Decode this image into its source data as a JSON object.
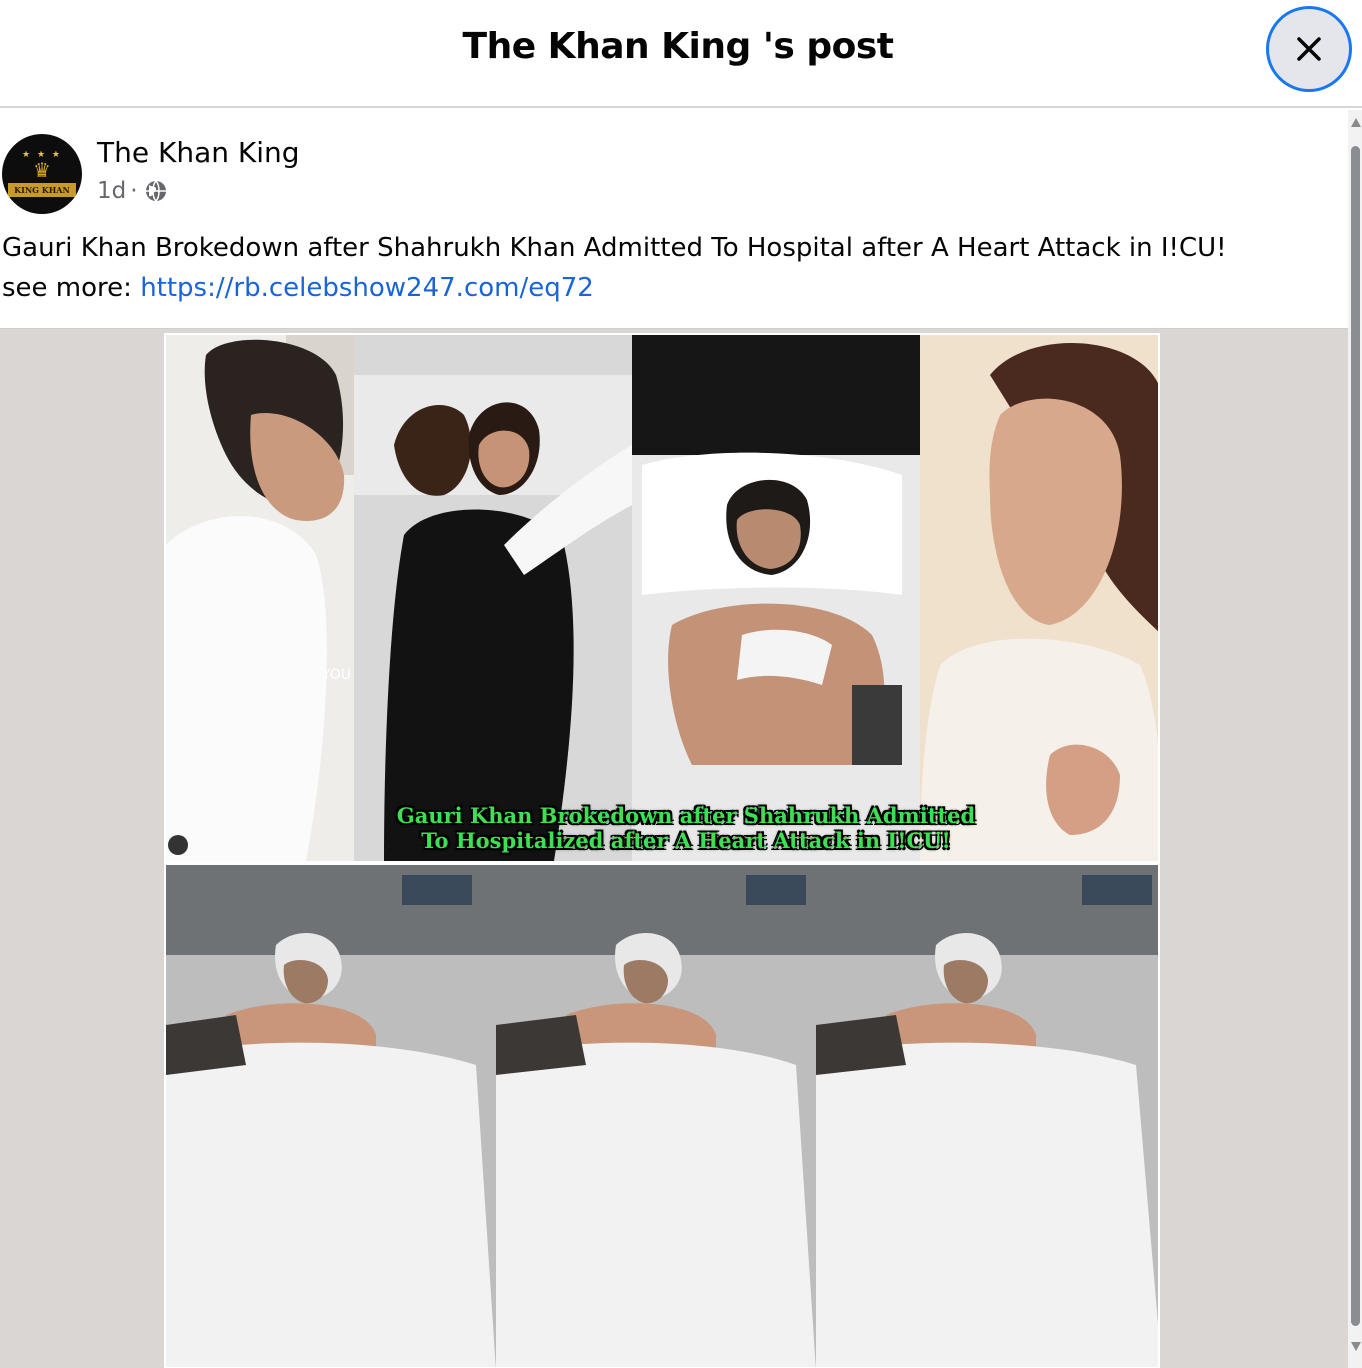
{
  "header": {
    "title": "The Khan King 's post",
    "close_icon": "close-icon"
  },
  "post": {
    "author": "The Khan King",
    "time": "1d",
    "separator": "·",
    "privacy_icon": "globe-icon",
    "avatar": {
      "banner_text": "KING KHAN"
    },
    "text_line1": "Gauri Khan Brokedown after Shahrukh Khan Admitted To Hospital after A Heart Attack in I!CU!",
    "see_more_label": "see more: ",
    "link": "https://rb.celebshow247.com/eq72",
    "image": {
      "caption_line1": "Gauri Khan Brokedown after Shahrukh Admitted",
      "caption_line2": "To Hospitalized after A Heart Attack in I!CU!",
      "watermark": "YOU"
    }
  },
  "colors": {
    "link": "#1a64d8",
    "close_border": "#1877f2",
    "caption_text": "#3de052",
    "media_background": "#d9d6d3"
  }
}
